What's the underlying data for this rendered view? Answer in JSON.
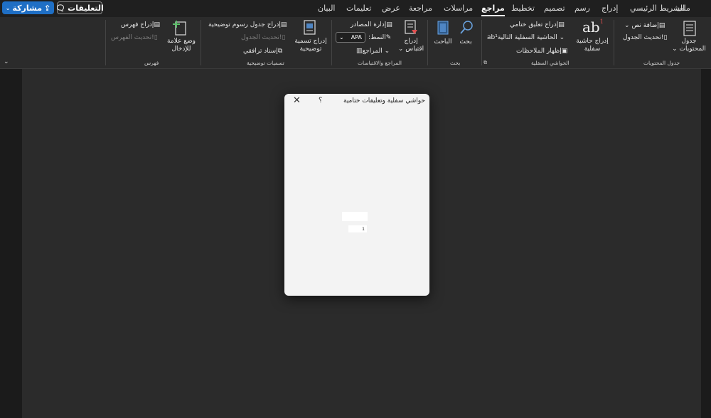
{
  "menu": {
    "tabs": [
      "ملف",
      "الشريط الرئيسي",
      "إدراج",
      "رسم",
      "تصميم",
      "تخطيط",
      "مراجع",
      "مراسلات",
      "مراجعة",
      "عرض",
      "تعليمات",
      "البيان"
    ],
    "active_tab": "مراجع",
    "comments_label": "التعليقات",
    "share_label": "مشاركة"
  },
  "ribbon": {
    "toc": {
      "group_label": "جدول المحتويات",
      "toc_button": "جدول المحتويات",
      "add_text": "إضافة نص",
      "update_table": "تحديث الجدول"
    },
    "footnotes": {
      "group_label": "الحواشي السفلية",
      "insert_footnote": "إدراج حاشية سفلية",
      "insert_endnote": "إدراج تعليق ختامي",
      "next_footnote": "الحاشية السفلية التالية",
      "show_notes": "إظهار الملاحظات"
    },
    "research": {
      "group_label": "بحث",
      "search": "بحث",
      "researcher": "الباحث"
    },
    "citations": {
      "group_label": "المراجع والاقتباسات",
      "insert_citation": "إدراج اقتباس",
      "manage_sources": "إدارة المصادر",
      "style_label": "النمط:",
      "style_value": "APA",
      "bibliography": "المراجع"
    },
    "captions": {
      "group_label": "تسميات توضيحية",
      "insert_caption": "إدراج تسمية توضيحية",
      "insert_table_of_figures": "إدراج جدول رسوم توضيحية",
      "update_table": "تحديث الجدول",
      "cross_reference": "إسناد ترافقي"
    },
    "index": {
      "group_label": "فهرس",
      "mark_entry": "وضع علامة للإدخال",
      "insert_index": "إدراج فهرس",
      "update_index": "تحديث الفهرس"
    }
  },
  "dialog": {
    "title": "حواشي سفلية وتعليقات ختامية",
    "help": "؟",
    "field_value": "1"
  },
  "colors": {
    "accent_blue": "#1f6fc5",
    "ribbon_bg": "#2b2b2b",
    "menubar_bg": "#1f1f1f",
    "dialog_bg": "#f3f3f3"
  }
}
